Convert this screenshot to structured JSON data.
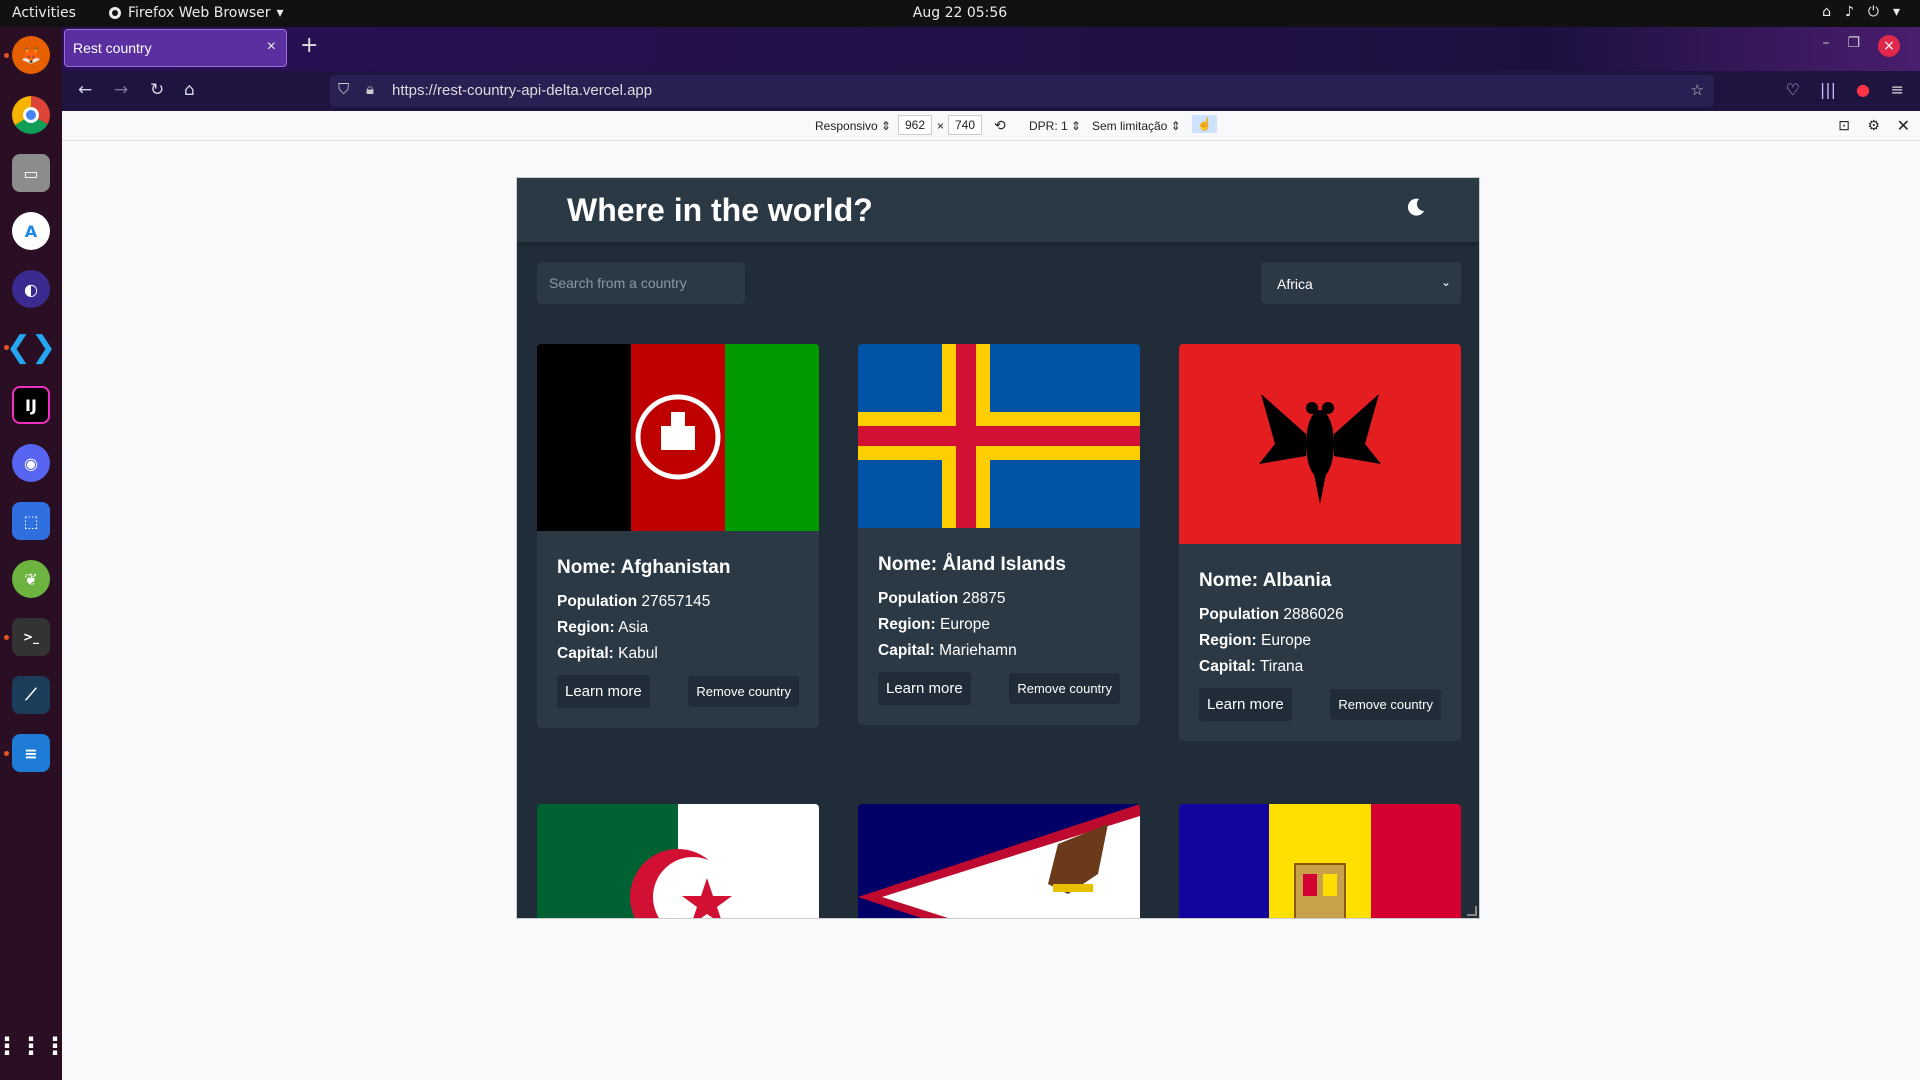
{
  "system": {
    "activities": "Activities",
    "app_name": "Firefox Web Browser",
    "clock": "Aug 22  05:56"
  },
  "browser": {
    "tab_title": "Rest country",
    "url": "https://rest-country-api-delta.vercel.app"
  },
  "rdm": {
    "device": "Responsivo",
    "width": "962",
    "times": "×",
    "height": "740",
    "dpr": "DPR: 1",
    "throttle": "Sem limitação"
  },
  "app": {
    "title": "Where in the world?",
    "search_placeholder": "Search from a country",
    "region_selected": "Africa",
    "labels": {
      "name": "Nome:",
      "population": "Population",
      "region": "Region:",
      "capital": "Capital:",
      "learn": "Learn more",
      "remove": "Remove country"
    },
    "countries": [
      {
        "name": "Afghanistan",
        "population": "27657145",
        "region": "Asia",
        "capital": "Kabul"
      },
      {
        "name": "Åland Islands",
        "population": "28875",
        "region": "Europe",
        "capital": "Mariehamn"
      },
      {
        "name": "Albania",
        "population": "2886026",
        "region": "Europe",
        "capital": "Tirana"
      }
    ]
  },
  "colors": {
    "background": "#202c37",
    "element": "#2b3945",
    "text": "#ffffff"
  }
}
